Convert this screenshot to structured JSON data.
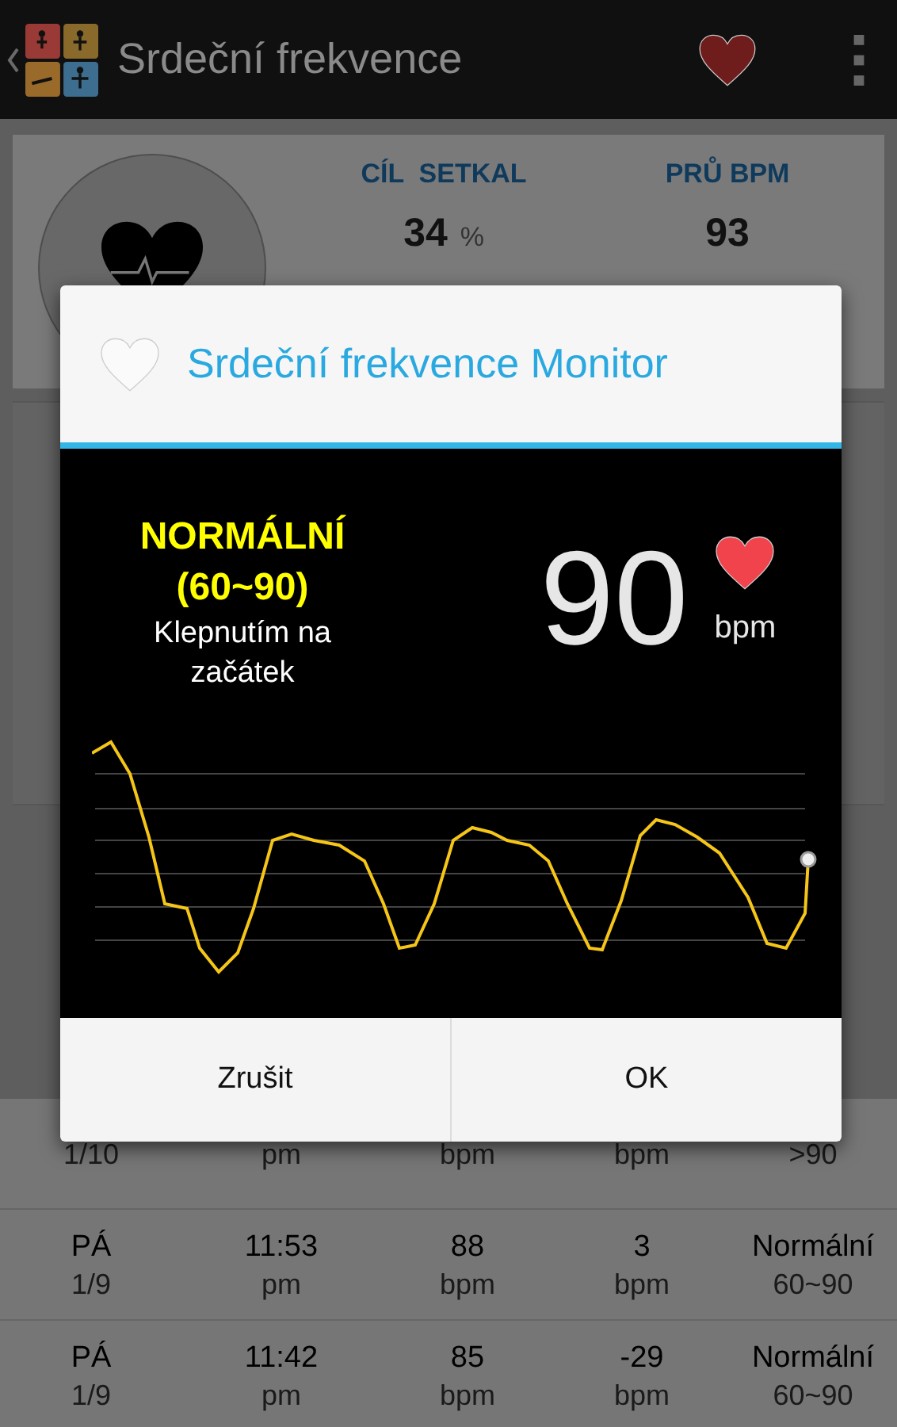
{
  "header": {
    "title": "Srdeční frekvence"
  },
  "summary": {
    "stats": [
      {
        "label": "CÍL  SETKAL",
        "value": "34",
        "unit": "%"
      },
      {
        "label": "PRŮ BPM",
        "value": "93"
      }
    ]
  },
  "dialog": {
    "title": "Srdeční frekvence Monitor",
    "status": "NORMÁLNÍ",
    "range": "(60~90)",
    "hint": "Klepnutím na začátek",
    "bpm": "90",
    "unit": "bpm",
    "buttons": [
      "Zrušit",
      "OK"
    ]
  },
  "history": [
    {
      "cells": [
        {
          "sub": "1/10"
        },
        {
          "sub": "pm"
        },
        {
          "sub": "bpm"
        },
        {
          "sub": "bpm"
        },
        {
          "sub": ">90"
        }
      ]
    },
    {
      "cells": [
        {
          "main": "PÁ",
          "sub": "1/9"
        },
        {
          "main": "11:53",
          "sub": "pm"
        },
        {
          "main": "88",
          "sub": "bpm"
        },
        {
          "main": "3",
          "sub": "bpm"
        },
        {
          "main": "Normální",
          "sub": "60~90"
        }
      ]
    },
    {
      "cells": [
        {
          "main": "PÁ",
          "sub": "1/9"
        },
        {
          "main": "11:42",
          "sub": "pm"
        },
        {
          "main": "85",
          "sub": "bpm"
        },
        {
          "main": "-29",
          "sub": "bpm"
        },
        {
          "main": "Normální",
          "sub": "60~90"
        }
      ]
    }
  ]
}
